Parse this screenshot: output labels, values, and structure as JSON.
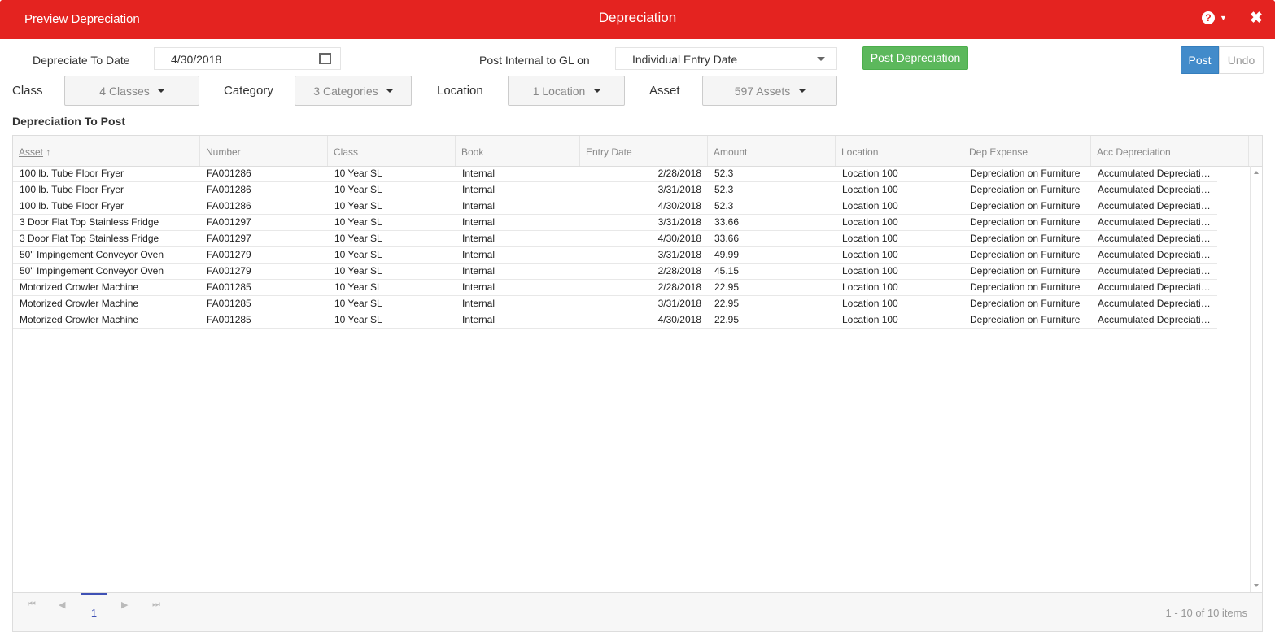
{
  "window": {
    "left_title": "Preview Depreciation",
    "title": "Depreciation",
    "help_glyph": "?",
    "close_glyph": "✖"
  },
  "filters": {
    "depreciate_to_date_label": "Depreciate To Date",
    "depreciate_to_date_value": "4/30/2018",
    "post_internal_label": "Post Internal to GL on",
    "post_internal_value": "Individual Entry Date",
    "post_depreciation_button": "Post Depreciation",
    "toggle_post": "Post",
    "toggle_undo": "Undo",
    "class_label": "Class",
    "class_value": "4 Classes",
    "category_label": "Category",
    "category_value": "3 Categories",
    "location_label": "Location",
    "location_value": "1 Location",
    "asset_label": "Asset",
    "asset_value": "597 Assets"
  },
  "section_title": "Depreciation To Post",
  "grid": {
    "columns": [
      "Asset",
      "Number",
      "Class",
      "Book",
      "Entry Date",
      "Amount",
      "Location",
      "Dep Expense",
      "Acc Depreciation"
    ],
    "sort_indicator": "↑",
    "rows": [
      [
        "100 lb. Tube Floor Fryer",
        "FA001286",
        "10 Year SL",
        "Internal",
        "2/28/2018",
        "52.3",
        "Location 100",
        "Depreciation on Furniture",
        "Accumulated Depreciation"
      ],
      [
        "100 lb. Tube Floor Fryer",
        "FA001286",
        "10 Year SL",
        "Internal",
        "3/31/2018",
        "52.3",
        "Location 100",
        "Depreciation on Furniture",
        "Accumulated Depreciation"
      ],
      [
        "100 lb. Tube Floor Fryer",
        "FA001286",
        "10 Year SL",
        "Internal",
        "4/30/2018",
        "52.3",
        "Location 100",
        "Depreciation on Furniture",
        "Accumulated Depreciation"
      ],
      [
        "3 Door Flat Top Stainless Fridge",
        "FA001297",
        "10 Year SL",
        "Internal",
        "3/31/2018",
        "33.66",
        "Location 100",
        "Depreciation on Furniture",
        "Accumulated Depreciation"
      ],
      [
        "3 Door Flat Top Stainless Fridge",
        "FA001297",
        "10 Year SL",
        "Internal",
        "4/30/2018",
        "33.66",
        "Location 100",
        "Depreciation on Furniture",
        "Accumulated Depreciation"
      ],
      [
        "50\" Impingement Conveyor Oven",
        "FA001279",
        "10 Year SL",
        "Internal",
        "3/31/2018",
        "49.99",
        "Location 100",
        "Depreciation on Furniture",
        "Accumulated Depreciation"
      ],
      [
        "50\" Impingement Conveyor Oven",
        "FA001279",
        "10 Year SL",
        "Internal",
        "2/28/2018",
        "45.15",
        "Location 100",
        "Depreciation on Furniture",
        "Accumulated Depreciation"
      ],
      [
        "Motorized Crowler Machine",
        "FA001285",
        "10 Year SL",
        "Internal",
        "2/28/2018",
        "22.95",
        "Location 100",
        "Depreciation on Furniture",
        "Accumulated Depreciation"
      ],
      [
        "Motorized Crowler Machine",
        "FA001285",
        "10 Year SL",
        "Internal",
        "3/31/2018",
        "22.95",
        "Location 100",
        "Depreciation on Furniture",
        "Accumulated Depreciation"
      ],
      [
        "Motorized Crowler Machine",
        "FA001285",
        "10 Year SL",
        "Internal",
        "4/30/2018",
        "22.95",
        "Location 100",
        "Depreciation on Furniture",
        "Accumulated Depreciation"
      ]
    ]
  },
  "pager": {
    "first": "⏮",
    "prev": "◀",
    "page": "1",
    "next": "▶",
    "last": "⏭",
    "info": "1 - 10 of 10 items"
  },
  "icons": {
    "help": "help-icon",
    "close": "close-icon",
    "calendar": "calendar-icon",
    "sort": "sort-ascending-icon"
  },
  "colors": {
    "titlebar": "#e42320",
    "post_depreciation": "#5cb85c",
    "toggle_active": "#428bca",
    "pager_active": "#3f51b5"
  }
}
